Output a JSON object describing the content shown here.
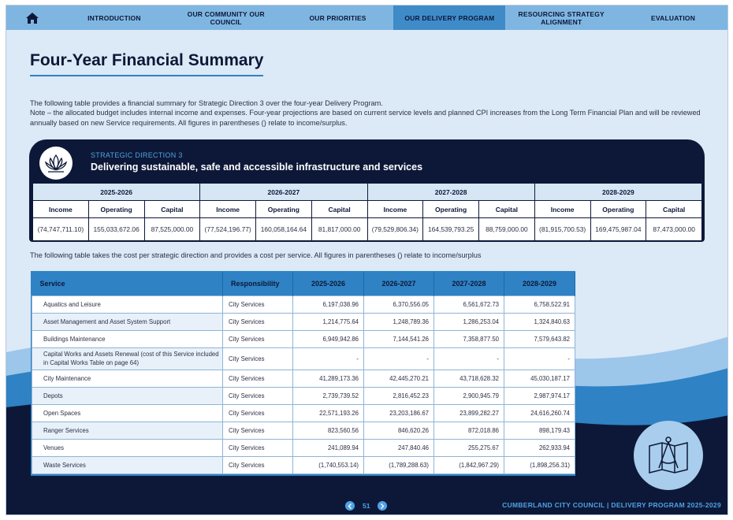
{
  "nav": {
    "items": [
      {
        "label": "INTRODUCTION",
        "active": false
      },
      {
        "label": "OUR COMMUNITY OUR COUNCIL",
        "active": false
      },
      {
        "label": "OUR PRIORITIES",
        "active": false
      },
      {
        "label": "OUR DELIVERY PROGRAM",
        "active": true
      },
      {
        "label": "RESOURCING STRATEGY ALIGNMENT",
        "active": false
      },
      {
        "label": "EVALUATION",
        "active": false
      }
    ],
    "home_icon": "home-icon"
  },
  "page_title": "Four-Year Financial Summary",
  "intro": {
    "line1": "The following table provides a financial summary for Strategic Direction 3 over the four-year Delivery Program.",
    "line2": "Note – the allocated budget includes internal income and expenses. Four-year projections are based on current service levels and planned CPI increases from the Long Term Financial Plan and will be reviewed annually based on new Service requirements. All figures in parentheses () relate to income/surplus."
  },
  "strategic_direction": {
    "kicker": "STRATEGIC DIRECTION 3",
    "heading": "Delivering sustainable, safe and accessible infrastructure and services",
    "icon": "lotus-icon"
  },
  "financial_summary": {
    "years": [
      "2025-2026",
      "2026-2027",
      "2027-2028",
      "2028-2029"
    ],
    "sub_headers": [
      "Income",
      "Operating",
      "Capital"
    ],
    "values": [
      "(74,747,711.10)",
      "155,033,672.06",
      "87,525,000.00",
      "(77,524,196.77)",
      "160,058,164.64",
      "81,817,000.00",
      "(79,529,806.34)",
      "164,539,793.25",
      "88,759,000.00",
      "(81,915,700.53)",
      "169,475,987.04",
      "87,473,000.00"
    ]
  },
  "note2": "The following table takes the cost per strategic direction and provides a cost per service. All figures in parentheses () relate to income/surplus",
  "service_table": {
    "headers": [
      "Service",
      "Responsibility",
      "2025-2026",
      "2026-2027",
      "2027-2028",
      "2028-2029"
    ],
    "rows": [
      [
        "Aquatics and Leisure",
        "City Services",
        "6,197,038.96",
        "6,370,556.05",
        "6,561,672.73",
        "6,758,522.91"
      ],
      [
        "Asset Management and Asset System Support",
        "City Services",
        "1,214,775.64",
        "1,248,789.36",
        "1,286,253.04",
        "1,324,840.63"
      ],
      [
        "Buildings Maintenance",
        "City Services",
        "6,949,942.86",
        "7,144,541.26",
        "7,358,877.50",
        "7,579,643.82"
      ],
      [
        "Capital Works and Assets Renewal (cost of this Service included in Capital Works Table on page 64)",
        "City Services",
        "-",
        "-",
        "-",
        "-"
      ],
      [
        "City Maintenance",
        "City Services",
        "41,289,173.36",
        "42,445,270.21",
        "43,718,628.32",
        "45,030,187.17"
      ],
      [
        "Depots",
        "City Services",
        "2,739,739.52",
        "2,816,452.23",
        "2,900,945.79",
        "2,987,974.17"
      ],
      [
        "Open Spaces",
        "City Services",
        "22,571,193.26",
        "23,203,186.67",
        "23,899,282.27",
        "24,616,260.74"
      ],
      [
        "Ranger Services",
        "City Services",
        "823,560.56",
        "846,620.26",
        "872,018.86",
        "898,179.43"
      ],
      [
        "Venues",
        "City Services",
        "241,089.94",
        "247,840.46",
        "255,275.67",
        "262,933.94"
      ],
      [
        "Waste Services",
        "City Services",
        "(1,740,553.14)",
        "(1,789,288.63)",
        "(1,842,967.29)",
        "(1,898,256.31)"
      ]
    ]
  },
  "footer": {
    "page_number": "51",
    "org": "CUMBERLAND CITY COUNCIL  |  DELIVERY PROGRAM 2025-2029"
  },
  "colors": {
    "navy": "#0d1838",
    "accent_blue": "#2f82c4",
    "light_blue": "#7fb6e1",
    "page_bg": "#dce9f6"
  }
}
